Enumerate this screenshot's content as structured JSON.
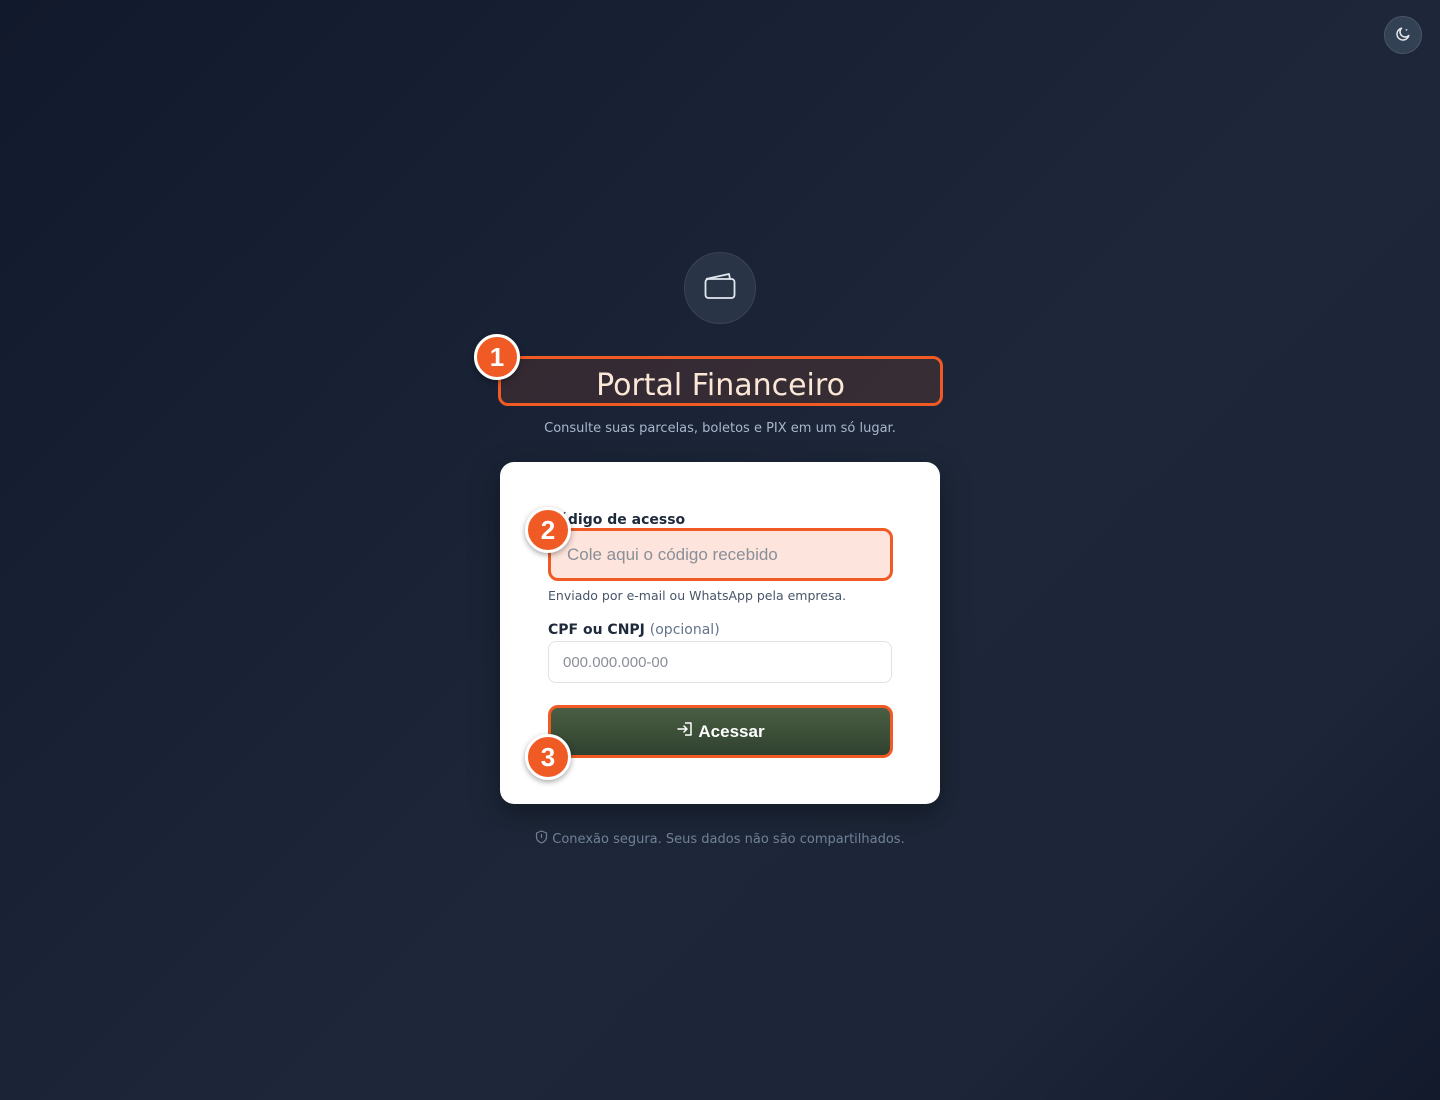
{
  "header": {
    "title": "Portal Financeiro",
    "subtitle": "Consulte suas parcelas, boletos e PIX em um só lugar."
  },
  "icons": {
    "theme_toggle": "moon-icon",
    "logo": "wallet-icon",
    "submit": "login-icon",
    "footer": "shield-icon"
  },
  "form": {
    "code_label": "Código de acesso",
    "code_placeholder": "Cole aqui o código recebido",
    "code_help": "Enviado por e-mail ou WhatsApp pela empresa.",
    "cpf_label": "CPF ou CNPJ",
    "cpf_optional": "(opcional)",
    "cpf_placeholder": "000.000.000-00",
    "submit_label": "Acessar"
  },
  "footer": {
    "text": "Conexão segura. Seus dados não são compartilhados."
  },
  "annotations": [
    {
      "number": "1"
    },
    {
      "number": "2"
    },
    {
      "number": "3"
    }
  ],
  "colors": {
    "accent": "#f05a24",
    "button": "#3e5239",
    "background": "#1d2739"
  }
}
